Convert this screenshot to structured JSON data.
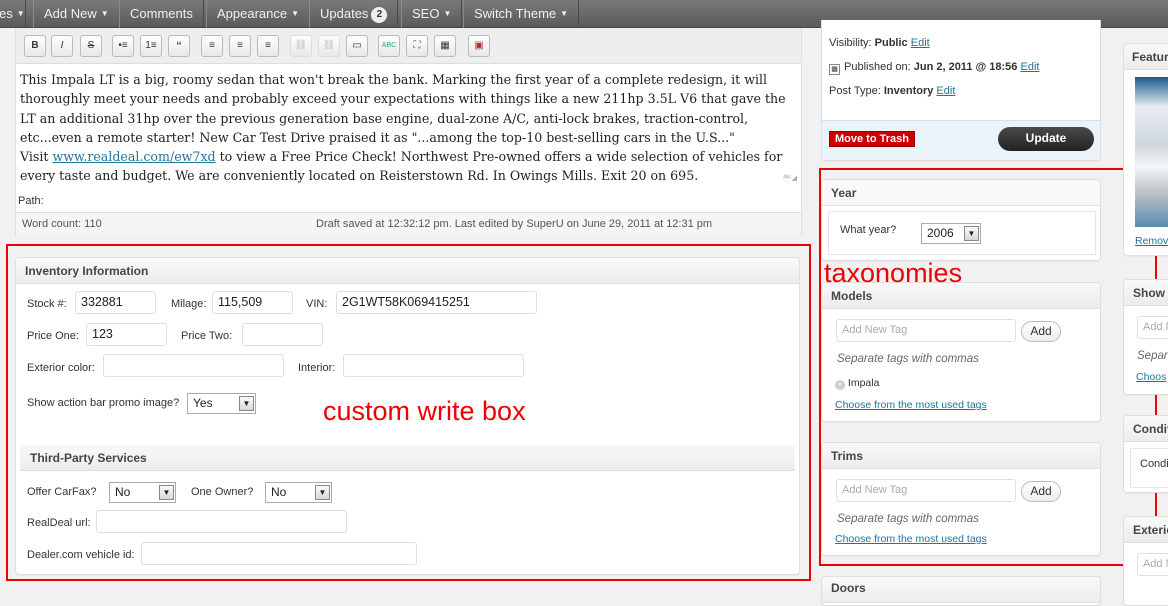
{
  "adminbar": {
    "items": [
      {
        "label": "es",
        "caret": true
      },
      {
        "label": "Add New",
        "caret": true
      },
      {
        "label": "Comments",
        "caret": false
      },
      {
        "label": "Appearance",
        "caret": true
      },
      {
        "label": "Updates",
        "badge": "2"
      },
      {
        "label": "SEO",
        "caret": true
      },
      {
        "label": "Switch Theme",
        "caret": true
      }
    ]
  },
  "editor": {
    "content_p1": "This Impala LT is a big, roomy sedan that won't break the bank. Marking the first year of a complete redesign, it will thoroughly meet your needs and probably exceed your expectations with things like a new 211hp 3.5L V6 that gave the LT an additional 31hp over the previous generation base engine, dual-zone A/C, anti-lock brakes, traction-control, etc...even a remote starter! New Car Test Drive praised it as \"...among the top-10 best-selling cars in the U.S...\"",
    "content_visit": "Visit ",
    "content_link": "www.realdeal.com/ew7xd",
    "content_p2": " to view a Free Price Check! Northwest Pre-owned offers a wide selection of vehicles for every taste and budget. We are conveniently located on Reisterstown Rd. In Owings Mills. Exit 20 on 695.",
    "path_label": "Path:",
    "word_count": "Word count: 110",
    "draft_status": "Draft saved at 12:32:12 pm. Last edited by SuperU on June 29, 2011 at 12:31 pm",
    "toolbar_buttons": [
      "B",
      "I",
      "S",
      "•≡",
      "1≡",
      "“",
      "≡",
      "≡",
      "≡",
      "⛓",
      "⛓",
      "▭",
      "ABC",
      "⛶",
      "▦",
      "▣"
    ]
  },
  "inventory": {
    "title": "Inventory Information",
    "stock_label": "Stock #:",
    "stock_value": "332881",
    "milage_label": "Milage:",
    "milage_value": "115,509",
    "vin_label": "VIN:",
    "vin_value": "2G1WT58K069415251",
    "price_one_label": "Price One:",
    "price_one_value": "123",
    "price_two_label": "Price Two:",
    "price_two_value": "",
    "exterior_label": "Exterior color:",
    "exterior_value": "",
    "interior_label": "Interior:",
    "interior_value": "",
    "promo_label": "Show action bar promo image?",
    "promo_value": "Yes"
  },
  "third_party": {
    "title": "Third-Party Services",
    "carfax_label": "Offer CarFax?",
    "carfax_value": "No",
    "one_owner_label": "One Owner?",
    "one_owner_value": "No",
    "realdeal_label": "RealDeal url:",
    "realdeal_value": "",
    "dealer_label": "Dealer.com vehicle id:",
    "dealer_value": ""
  },
  "annotations": {
    "custom_write_box": "custom write box",
    "taxonomies": "taxonomies"
  },
  "publish": {
    "visibility_label": "Visibility:",
    "visibility_value": "Public",
    "visibility_edit": "Edit",
    "published_label": "Published on:",
    "published_value": "Jun 2, 2011 @ 18:56",
    "published_edit": "Edit",
    "post_type_label": "Post Type:",
    "post_type_value": "Inventory",
    "post_type_edit": "Edit",
    "trash_label": "Move to Trash",
    "update_label": "Update"
  },
  "year_box": {
    "title": "Year",
    "label": "What year?",
    "value": "2006"
  },
  "models_box": {
    "title": "Models",
    "placeholder": "Add New Tag",
    "add_label": "Add",
    "hint": "Separate tags with commas",
    "tag": "Impala",
    "choose_link": "Choose from the most used tags"
  },
  "trims_box": {
    "title": "Trims",
    "placeholder": "Add New Tag",
    "add_label": "Add",
    "hint": "Separate tags with commas",
    "choose_link": "Choose from the most used tags"
  },
  "doors_box": {
    "title": "Doors"
  },
  "right_col": {
    "featured_title": "Featur",
    "featured_remove": "Remov",
    "show_title": "Show c",
    "show_input": "Add N",
    "show_hint": "Separ",
    "show_link": "Choos",
    "condition_title": "Conditi",
    "condition_label": "Condi",
    "exterior_title": "Exterio",
    "exterior_input": "Add N"
  }
}
